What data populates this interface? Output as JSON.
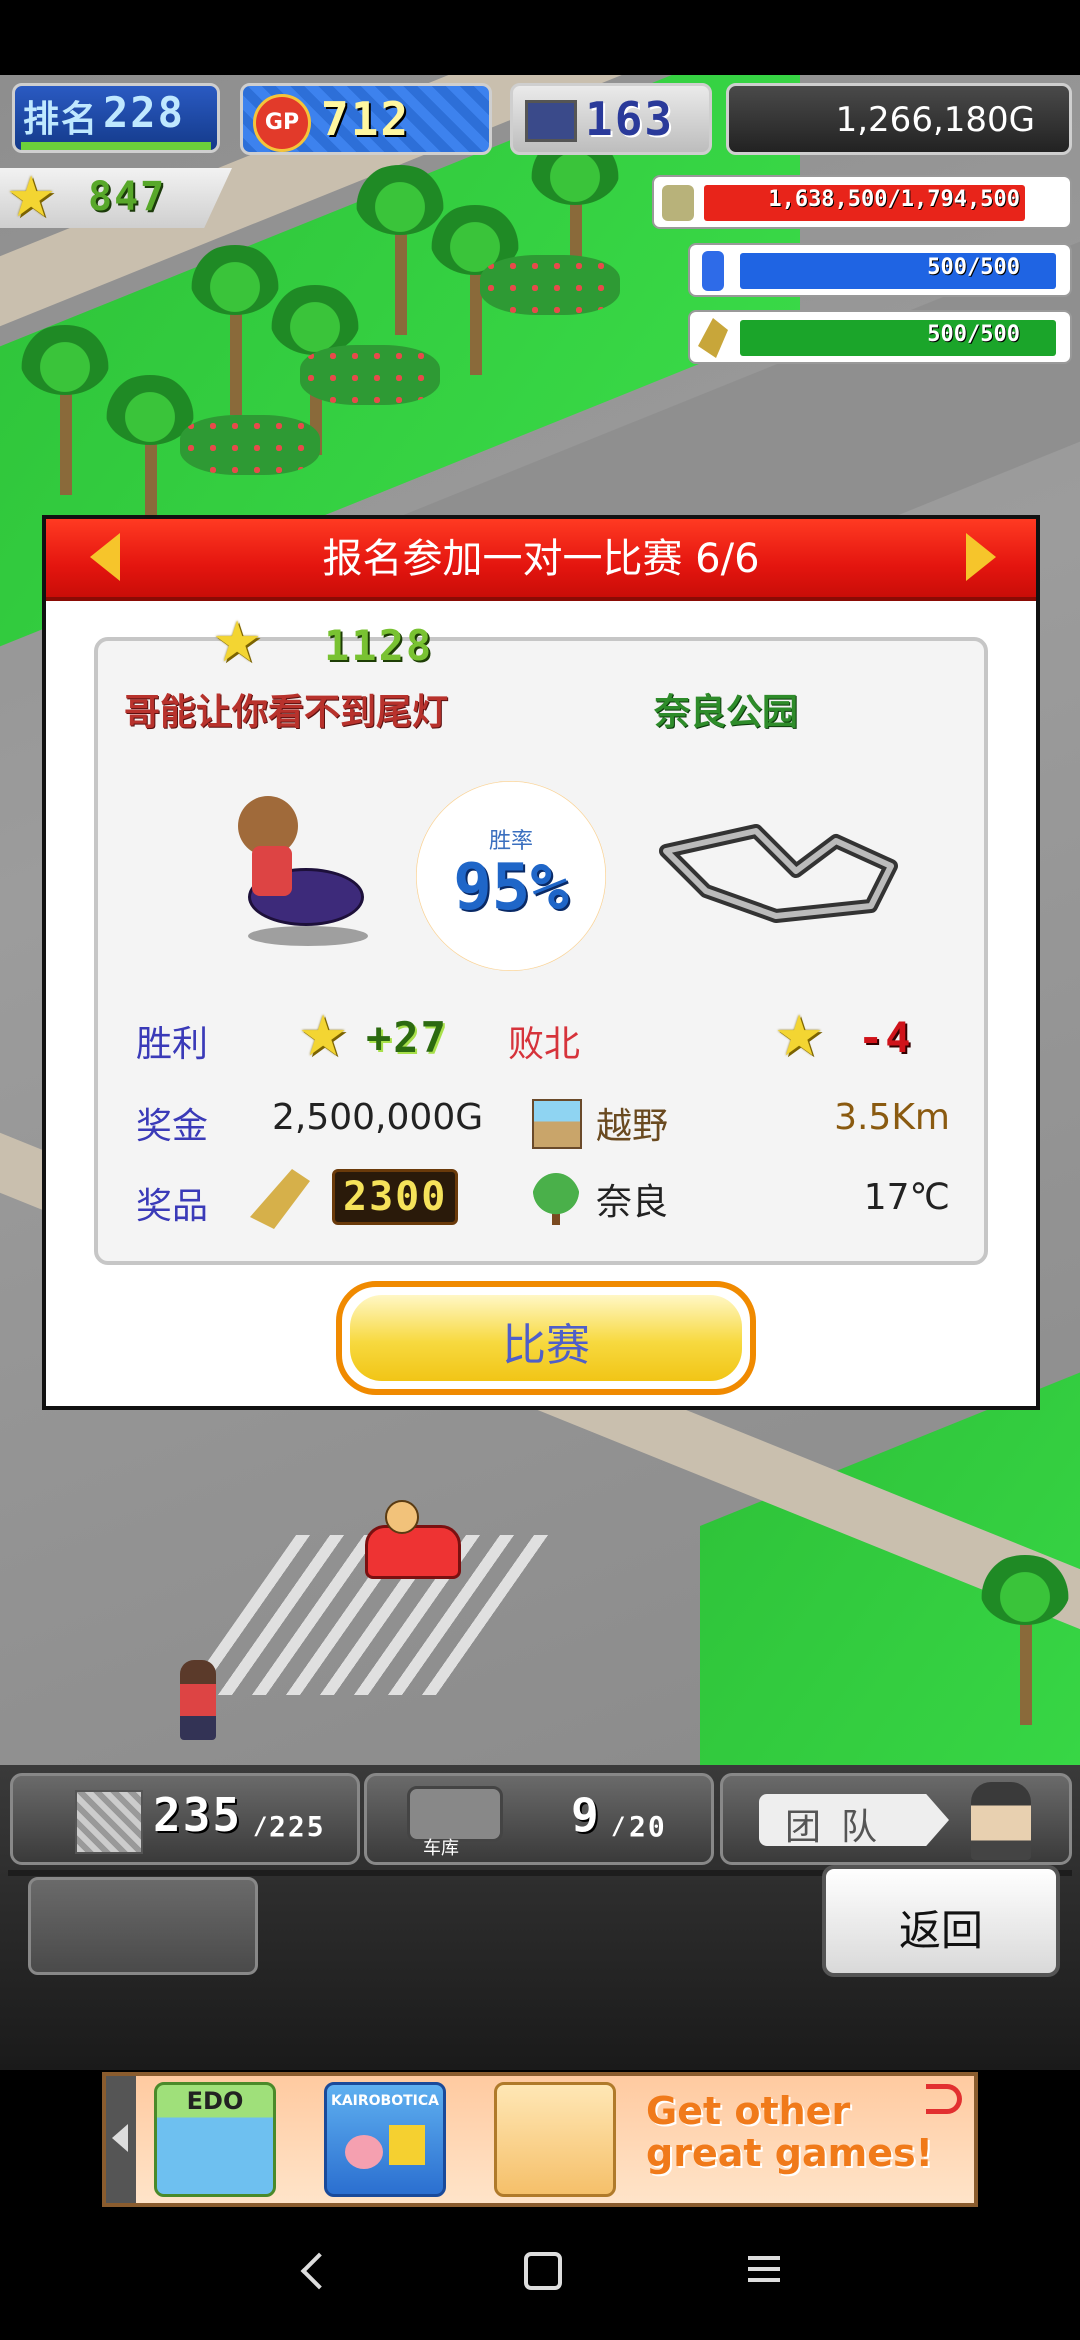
{
  "hud": {
    "rank_label": "排名",
    "rank_value": "228",
    "gp_badge": "GP",
    "gp_value": "712",
    "computer_value": "163",
    "money": "1,266,180G",
    "star_value": "847",
    "bars": [
      {
        "icon": "coins-icon",
        "text": "1,638,500/1,794,500",
        "fraction": 0.913,
        "color": "#e8241a"
      },
      {
        "icon": "fuel-icon",
        "text": "500/500",
        "fraction": 1.0,
        "color": "#1f64e3"
      },
      {
        "icon": "wheat-icon",
        "text": "500/500",
        "fraction": 1.0,
        "color": "#1ba52a"
      }
    ]
  },
  "dialog": {
    "title": "报名参加一对一比赛 6/6",
    "opponent_stars": "1128",
    "opponent_name": "哥能让你看不到尾灯",
    "course_name": "奈良公园",
    "win_rate_label": "胜率",
    "win_rate": "95%",
    "win_label": "胜利",
    "win_reward": "+27",
    "lose_label": "败北",
    "lose_penalty": "-4",
    "prize_money_label": "奖金",
    "prize_money": "2,500,000G",
    "terrain": "越野",
    "distance": "3.5Km",
    "prize_item_label": "奖品",
    "prize_item_value": "2300",
    "location": "奈良",
    "temperature": "17℃",
    "race_button": "比赛"
  },
  "bottom": {
    "parts_value": "235",
    "parts_max": "225",
    "garage_label": "车库",
    "garage_value": "9",
    "garage_max": "20",
    "team_label": "团队",
    "back_button": "返回"
  },
  "ad": {
    "game1": "EDO",
    "game2": "KAIROBOTICA",
    "tagline": "Get other great games!"
  },
  "colors": {
    "header_red": "#e4150f",
    "button_orange": "#f08a00",
    "button_text": "#4f5fc9",
    "label_blue": "#3a3ab8",
    "label_red": "#d6333b"
  }
}
